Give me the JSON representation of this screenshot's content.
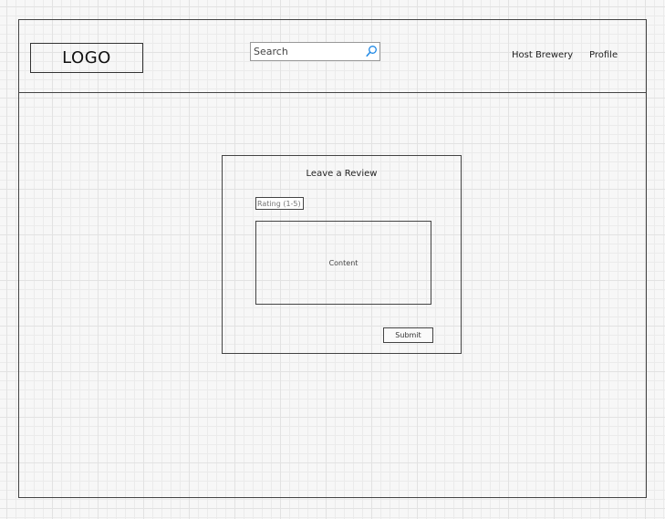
{
  "header": {
    "logo_text": "LOGO",
    "search": {
      "placeholder": "Search",
      "icon": "search-icon"
    },
    "nav": {
      "host_brewery": "Host Brewery",
      "profile": "Profile"
    }
  },
  "review": {
    "title": "Leave a Review",
    "rating_placeholder": "Rating (1-5)",
    "content_placeholder": "Content",
    "submit_label": "Submit"
  },
  "colors": {
    "line": "#444444",
    "grid": "#e2e2e2",
    "search_icon": "#1e88e5"
  }
}
